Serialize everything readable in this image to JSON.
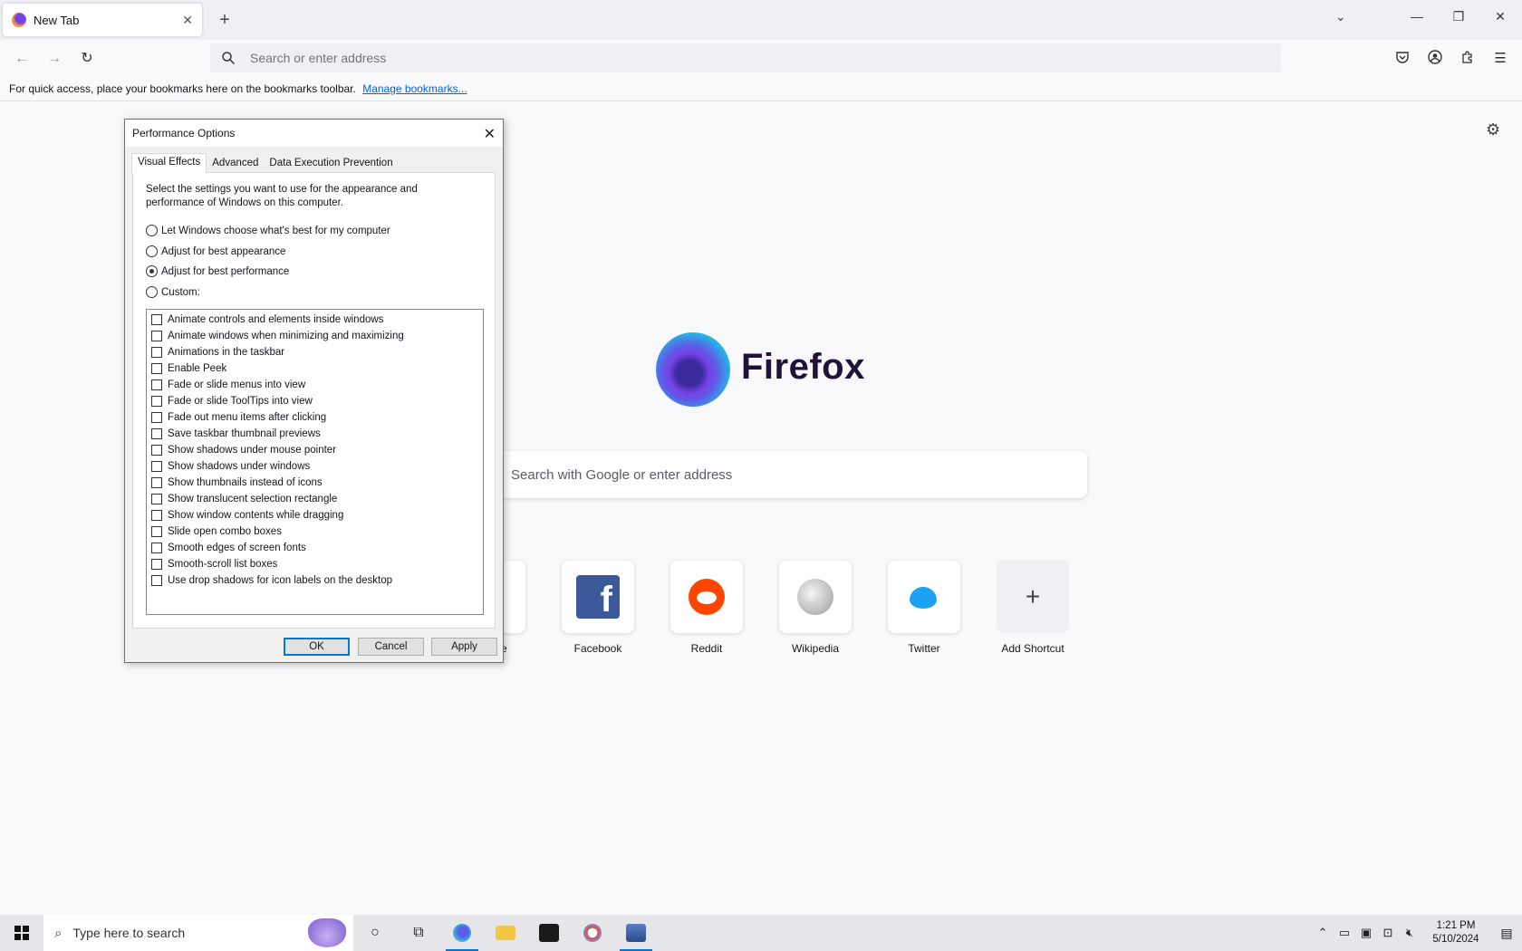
{
  "browser": {
    "tab_title": "New Tab",
    "url_placeholder": "Search or enter address",
    "bookmarks_hint": "For quick access, place your bookmarks here on the bookmarks toolbar.",
    "manage_bookmarks": "Manage bookmarks..."
  },
  "newtab": {
    "brand": "Firefox",
    "search_placeholder": "Search with Google or enter address",
    "shortcuts": [
      {
        "label": "e",
        "icon": "partial-shortcut-icon"
      },
      {
        "label": "Facebook",
        "icon": "facebook-icon"
      },
      {
        "label": "Reddit",
        "icon": "reddit-icon"
      },
      {
        "label": "Wikipedia",
        "icon": "wikipedia-icon"
      },
      {
        "label": "Twitter",
        "icon": "twitter-icon"
      },
      {
        "label": "Add Shortcut",
        "icon": "plus-icon"
      }
    ]
  },
  "dialog": {
    "title": "Performance Options",
    "tabs": [
      "Visual Effects",
      "Advanced",
      "Data Execution Prevention"
    ],
    "active_tab": "Visual Effects",
    "intro": "Select the settings you want to use for the appearance and performance of Windows on this computer.",
    "options": [
      {
        "label": "Let Windows choose what's best for my computer",
        "selected": false
      },
      {
        "label": "Adjust for best appearance",
        "selected": false
      },
      {
        "label": "Adjust for best performance",
        "selected": true
      },
      {
        "label": "Custom:",
        "selected": false
      }
    ],
    "effects": [
      "Animate controls and elements inside windows",
      "Animate windows when minimizing and maximizing",
      "Animations in the taskbar",
      "Enable Peek",
      "Fade or slide menus into view",
      "Fade or slide ToolTips into view",
      "Fade out menu items after clicking",
      "Save taskbar thumbnail previews",
      "Show shadows under mouse pointer",
      "Show shadows under windows",
      "Show thumbnails instead of icons",
      "Show translucent selection rectangle",
      "Show window contents while dragging",
      "Slide open combo boxes",
      "Smooth edges of screen fonts",
      "Smooth-scroll list boxes",
      "Use drop shadows for icon labels on the desktop"
    ],
    "buttons": {
      "ok": "OK",
      "cancel": "Cancel",
      "apply": "Apply"
    }
  },
  "taskbar": {
    "search_placeholder": "Type here to search",
    "time": "1:21 PM",
    "date": "5/10/2024"
  }
}
